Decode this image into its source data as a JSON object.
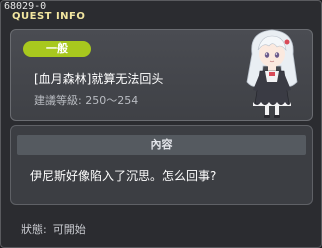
{
  "window": {
    "quest_id": "68029-0",
    "title": "QUEST INFO"
  },
  "quest": {
    "category": "一般",
    "name": "[血月森林]就算无法回头",
    "level": "建議等級: 250～254"
  },
  "content": {
    "header": "內容",
    "text": "伊尼斯好像陷入了沉思。怎么回事?"
  },
  "status": {
    "label": "狀態:",
    "value": "可開始"
  },
  "colors": {
    "badge": "#a8c81e",
    "title": "#f2e6a0",
    "panel": "#2b2c30"
  },
  "portrait": {
    "icon": "npc-portrait-white-haired-girl"
  }
}
